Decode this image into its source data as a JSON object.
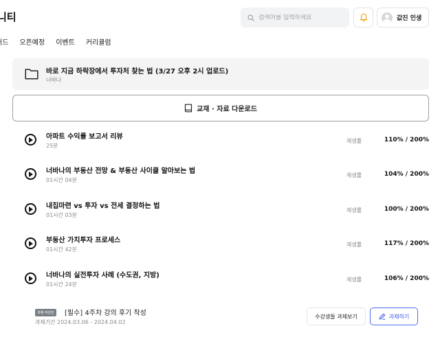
{
  "header": {
    "brand": "니티",
    "search_placeholder": "검색어를 입력하세요",
    "profile_name": "값진 인생",
    "bell_color": "#f2a516"
  },
  "nav": {
    "items": [
      "버드",
      "오픈예정",
      "이벤트",
      "커리큘럼"
    ]
  },
  "folder": {
    "title": "바로 지금 하락장에서 투자처 찾는 법 (3/27 오후 2시 업로드)",
    "author": "너바나"
  },
  "download": {
    "label": "교재 · 자료 다운로드"
  },
  "lessons": [
    {
      "title": "아파트 수익률 보고서 리뷰",
      "duration": "25분",
      "speed_label": "재생률",
      "speed": "110% / 200%"
    },
    {
      "title": "너바나의 부동산 전망 & 부동산 사이클 알아보는 법",
      "duration": "01시간 04분",
      "speed_label": "재생률",
      "speed": "104% / 200%"
    },
    {
      "title": "내집마련 vs 투자 vs 전세 결정하는 법",
      "duration": "01시간 03분",
      "speed_label": "재생률",
      "speed": "100% / 200%"
    },
    {
      "title": "부동산 가치투자 프로세스",
      "duration": "01시간 42분",
      "speed_label": "재생률",
      "speed": "117% / 200%"
    },
    {
      "title": "너바나의 실전투자 사례 (수도권, 지방)",
      "duration": "01시간 24분",
      "speed_label": "재생률",
      "speed": "106% / 200%"
    }
  ],
  "assignment": {
    "badge": "과제 작성전",
    "title": "[필수] 4주차 강의 후기 작성",
    "period": "과제기간 2024.03.06 - 2024.04.02",
    "view_button": "수강생들 과제보기",
    "do_button": "과제하기"
  }
}
